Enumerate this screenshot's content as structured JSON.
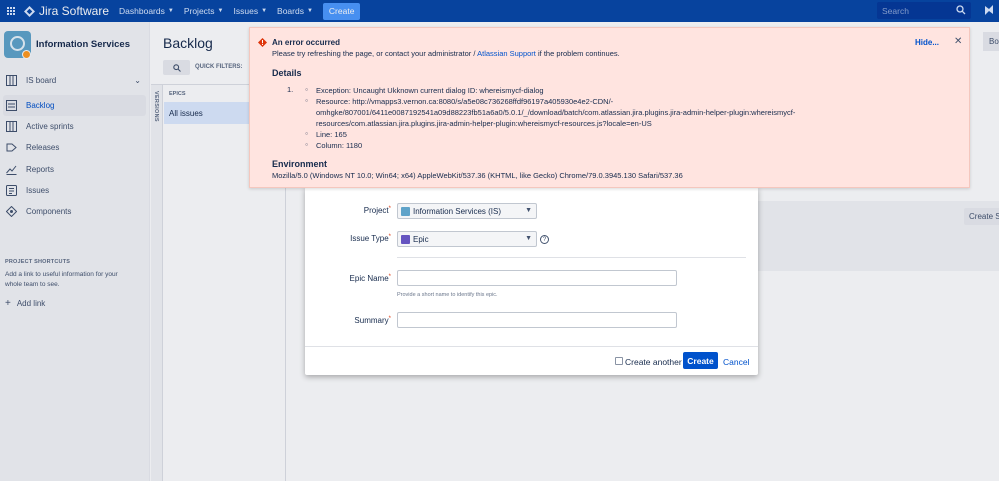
{
  "topnav": {
    "logo_text": "Jira Software",
    "menus": [
      "Dashboards",
      "Projects",
      "Issues",
      "Boards"
    ],
    "create_label": "Create",
    "search_placeholder": "Search"
  },
  "sidebar": {
    "project_name": "Information Services",
    "items": [
      {
        "label": "IS board",
        "icon": "board-icon"
      },
      {
        "label": "Backlog",
        "icon": "backlog-icon"
      },
      {
        "label": "Active sprints",
        "icon": "sprints-icon"
      },
      {
        "label": "Releases",
        "icon": "releases-icon"
      },
      {
        "label": "Reports",
        "icon": "reports-icon"
      },
      {
        "label": "Issues",
        "icon": "issues-icon"
      },
      {
        "label": "Components",
        "icon": "components-icon"
      }
    ],
    "shortcuts_heading": "PROJECT SHORTCUTS",
    "shortcuts_text": "Add a link to useful information for your whole team to see.",
    "add_link": "Add link"
  },
  "backlog": {
    "title": "Backlog",
    "quick_filters_label": "QUICK FILTERS:",
    "versions_label": "VERSIONS",
    "epics_label": "EPICS",
    "all_issues": "All issues",
    "create_sprint": "Create S",
    "top_right_button": "Bo"
  },
  "dialog": {
    "project_label": "Project",
    "project_value": "Information Services (IS)",
    "issue_type_label": "Issue Type",
    "issue_type_value": "Epic",
    "epic_name_label": "Epic Name",
    "epic_name_hint": "Provide a short name to identify this epic.",
    "summary_label": "Summary",
    "create_another": "Create another",
    "create_button": "Create",
    "cancel": "Cancel"
  },
  "error": {
    "title": "An error occurred",
    "message_pre": "Please try refreshing the page, or contact your administrator / ",
    "message_link": "Atlassian Support",
    "message_post": " if the problem continues.",
    "hide": "Hide...",
    "details_heading": "Details",
    "list_number": "1.",
    "exception": "Exception: Uncaught Ukknown current dialog ID: whereismycf-dialog",
    "resource_line1": "Resource: http://vmapps3.vernon.ca:8080/s/a5e08c736268ffdf96197a405930e4e2-CDN/-",
    "resource_line2": "omhgke/807001/6411e0087192541a09d88223fb51a6a0/5.0.1/_/download/batch/com.atlassian.jira.plugins.jira-admin-helper-plugin:whereismycf-",
    "resource_line3": "resources/com.atlassian.jira.plugins.jira-admin-helper-plugin:whereismycf-resources.js?locale=en-US",
    "line": "Line: 165",
    "column": "Column: 1180",
    "environment_heading": "Environment",
    "environment_text": "Mozilla/5.0 (Windows NT 10.0; Win64; x64) AppleWebKit/537.36 (KHTML, like Gecko) Chrome/79.0.3945.130 Safari/537.36"
  },
  "colors": {
    "nav_bg": "#0747a6",
    "accent": "#0052cc",
    "error_bg": "#ffe4e0",
    "error_icon": "#de350b"
  }
}
